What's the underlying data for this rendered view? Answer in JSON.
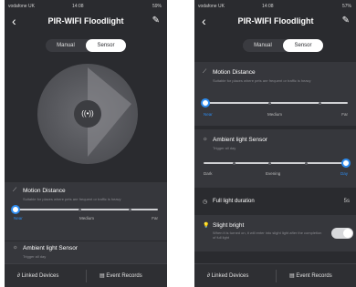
{
  "status": {
    "carrier": "vodafone UK",
    "time": "14:08",
    "battery_left": "59%",
    "battery_right": "57%"
  },
  "header": {
    "title": "PIR-WIFI Floodlight",
    "back_icon": "chevron-left-icon",
    "edit_icon": "edit-icon"
  },
  "mode": {
    "options": [
      "Manual",
      "Sensor"
    ],
    "selected": "Sensor"
  },
  "radar": {
    "center_icon": "wireless-signal-icon",
    "center_glyph": "((•))"
  },
  "motion": {
    "title": "Motion Distance",
    "desc": "Suitable for places where pets are frequent or traffic is heavy",
    "ticks": [
      "Near",
      "Medium",
      "Far"
    ],
    "value": "Near"
  },
  "ambient": {
    "title": "Ambient light Sensor",
    "desc": "Trigger all day",
    "ticks": [
      "Dark",
      "Evening",
      "Day"
    ],
    "value": "Day"
  },
  "full_light": {
    "label": "Full light duration",
    "value": "5s"
  },
  "slight": {
    "title": "Slight bright",
    "desc": "When it is turned on, it will enter into slight light after the completion of full light",
    "on": true
  },
  "bottom": {
    "linked": "Linked Devices",
    "events": "Event Records"
  },
  "colors": {
    "accent": "#2d8cf0",
    "background": "#2a2b2f",
    "card": "#36373c"
  }
}
